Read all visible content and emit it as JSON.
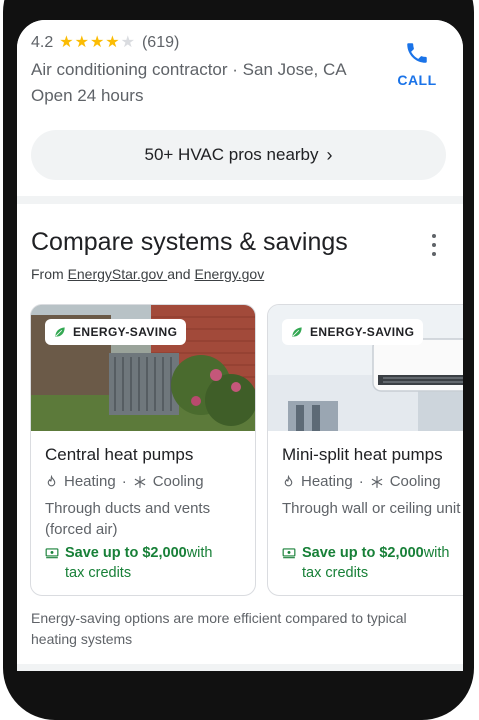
{
  "listing": {
    "rating": "4.2",
    "stars_filled": 4,
    "review_count": "(619)",
    "business_type": "Air conditioning contractor · San Jose, CA",
    "hours": "Open 24 hours",
    "call_label": "CALL"
  },
  "pros_nearby": {
    "label": "50+ HVAC pros nearby"
  },
  "compare": {
    "title": "Compare systems & savings",
    "source_prefix": "From ",
    "source_link_1": "EnergyStar.gov ",
    "source_and": " and ",
    "source_link_2": "Energy.gov",
    "cards": [
      {
        "badge": "ENERGY-SAVING",
        "title": "Central heat pumps",
        "tag_heating": "Heating",
        "tag_sep": "·",
        "tag_cooling": "Cooling",
        "desc_line1": "Through ducts and vents",
        "desc_line2": "(forced air)",
        "save_bold": "Save up to $2,000",
        "save_rest": " with",
        "save_line2": "tax credits"
      },
      {
        "badge": "ENERGY-SAVING",
        "title": "Mini-split heat pumps",
        "tag_heating": "Heating",
        "tag_sep": "·",
        "tag_cooling": "Cooling",
        "desc_line1": "Through wall or ceiling unit",
        "save_bold": "Save up to $2,000",
        "save_rest": " with",
        "save_line2": "tax credits"
      }
    ],
    "footnote": "Energy-saving options are more efficient compared to typical heating systems"
  },
  "colors": {
    "accent": "#1a73e8",
    "star": "#fbbc04",
    "save_green": "#188038"
  },
  "icons": [
    "phone-icon",
    "chevron-right-icon",
    "more-vert-icon",
    "leaf-icon",
    "flame-icon",
    "snowflake-icon",
    "money-icon"
  ]
}
